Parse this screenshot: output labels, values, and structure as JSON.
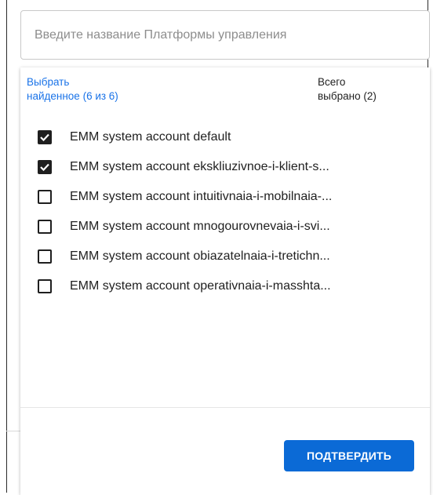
{
  "search": {
    "placeholder": "Введите название Платформы управления",
    "value": ""
  },
  "header": {
    "select_found_line1": "Выбрать",
    "select_found_line2": "найденное (6 из 6)",
    "total_line1": "Всего",
    "total_line2": "выбрано (2)"
  },
  "items": [
    {
      "label": "EMM system account default",
      "checked": true
    },
    {
      "label": "EMM system account ekskliuzivnoe-i-klient-s...",
      "checked": true
    },
    {
      "label": "EMM system account intuitivnaia-i-mobilnaia-...",
      "checked": false
    },
    {
      "label": "EMM system account mnogourovnevaia-i-svi...",
      "checked": false
    },
    {
      "label": "EMM system account obiazatelnaia-i-tretichn...",
      "checked": false
    },
    {
      "label": "EMM system account operativnaia-i-masshta...",
      "checked": false
    }
  ],
  "footer": {
    "confirm_label": "ПОДТВЕРДИТЬ"
  },
  "icons": {
    "checkbox_checked": "checkmark-icon"
  },
  "colors": {
    "accent": "#1a73e8",
    "button": "#0b6ad6"
  }
}
